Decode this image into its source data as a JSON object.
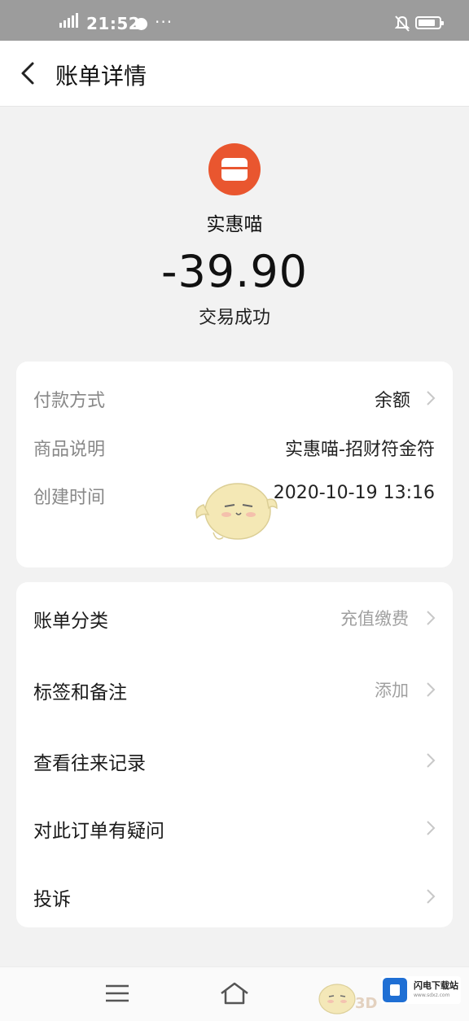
{
  "status_bar": {
    "time": "21:52",
    "more": "···"
  },
  "header": {
    "title": "账单详情"
  },
  "summary": {
    "merchant_name": "实惠喵",
    "amount": "-39.90",
    "status": "交易成功",
    "logo_color": "#e9562f"
  },
  "details": [
    {
      "label": "付款方式",
      "value": "余额"
    },
    {
      "label": "商品说明",
      "value": "实惠喵-招财符金符"
    },
    {
      "label": "创建时间",
      "value": "2020-10-19 13:16"
    }
  ],
  "actions": [
    {
      "label": "账单分类",
      "value": "充值缴费"
    },
    {
      "label": "标签和备注",
      "value": "添加"
    },
    {
      "label": "查看往来记录",
      "value": ""
    },
    {
      "label": "对此订单有疑问",
      "value": ""
    },
    {
      "label": "投诉",
      "value": ""
    }
  ],
  "watermark": {
    "brand": "闪电下载站",
    "url": "www.sdxz.com",
    "tag": "3D"
  },
  "colors": {
    "accent": "#e9562f",
    "background": "#f2f2f2",
    "status_bar": "#9c9c9c"
  }
}
